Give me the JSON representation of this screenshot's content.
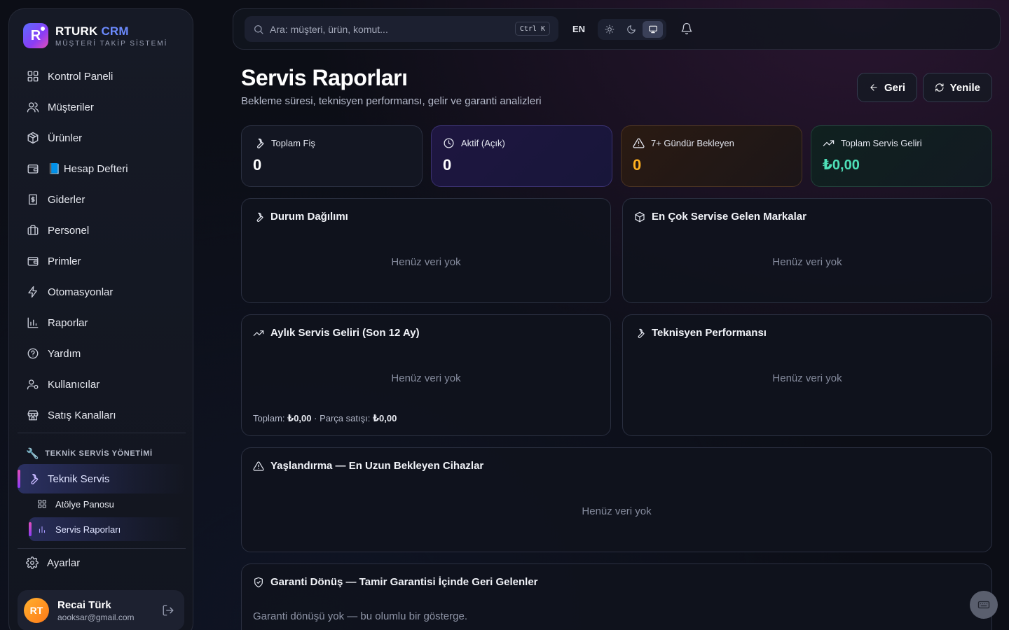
{
  "brand": {
    "name": "RTURK",
    "name_accent": "CRM",
    "subtitle": "MÜŞTERİ TAKİP SİSTEMİ",
    "logo_letter": "R"
  },
  "sidebar": {
    "items": [
      {
        "label": "Kontrol Paneli",
        "icon": "dashboard-icon"
      },
      {
        "label": "Müşteriler",
        "icon": "users-icon"
      },
      {
        "label": "Ürünler",
        "icon": "package-icon"
      },
      {
        "label": "📘 Hesap Defteri",
        "icon": "wallet-icon"
      },
      {
        "label": "Giderler",
        "icon": "receipt-icon"
      },
      {
        "label": "Personel",
        "icon": "briefcase-icon"
      },
      {
        "label": "Primler",
        "icon": "wallet-icon"
      },
      {
        "label": "Otomasyonlar",
        "icon": "zap-icon"
      },
      {
        "label": "Raporlar",
        "icon": "bar-chart-icon"
      },
      {
        "label": "Yardım",
        "icon": "help-circle-icon"
      },
      {
        "label": "Kullanıcılar",
        "icon": "user-cog-icon"
      },
      {
        "label": "Satış Kanalları",
        "icon": "store-icon"
      }
    ],
    "section_emoji": "🔧",
    "section_label": "TEKNİK SERVİS YÖNETİMİ",
    "active_item": "Teknik Servis",
    "sub_items": [
      {
        "label": "Atölye Panosu",
        "icon": "dashboard-icon"
      },
      {
        "label": "Servis Raporları",
        "icon": "bar-chart-icon"
      }
    ],
    "settings": "Ayarlar",
    "user": {
      "initials": "RT",
      "name": "Recai Türk",
      "email": "aooksar@gmail.com"
    }
  },
  "topbar": {
    "search_placeholder": "Ara: müşteri, ürün, komut...",
    "shortcut": "Ctrl K",
    "language": "EN",
    "theme_options": [
      "sun-icon",
      "moon-icon",
      "monitor-icon"
    ],
    "theme_selected": "monitor-icon"
  },
  "page": {
    "title": "Servis Raporları",
    "subtitle": "Bekleme süresi, teknisyen performansı, gelir ve garanti analizleri",
    "back_label": "Geri",
    "refresh_label": "Yenile"
  },
  "stats": [
    {
      "label": "Toplam Fiş",
      "value": "0",
      "icon": "wrench-icon"
    },
    {
      "label": "Aktif (Açık)",
      "value": "0",
      "icon": "clock-icon"
    },
    {
      "label": "7+ Gündür Bekleyen",
      "value": "0",
      "icon": "alert-triangle-icon",
      "color": "#ffb020"
    },
    {
      "label": "Toplam Servis Geliri",
      "value": "₺0,00",
      "icon": "trending-up-icon",
      "color": "#4ee0b8"
    }
  ],
  "panels": {
    "status": {
      "title": "Durum Dağılımı",
      "empty": "Henüz veri yok"
    },
    "brands": {
      "title": "En Çok Servise Gelen Markalar",
      "empty": "Henüz veri yok"
    },
    "monthly": {
      "title": "Aylık Servis Geliri (Son 12 Ay)",
      "empty": "Henüz veri yok",
      "total_label": "Toplam:",
      "total_value": "₺0,00",
      "parts_label": "· Parça satışı:",
      "parts_value": "₺0,00"
    },
    "technician": {
      "title": "Teknisyen Performansı",
      "empty": "Henüz veri yok"
    },
    "aging": {
      "title": "Yaşlandırma — En Uzun Bekleyen Cihazlar",
      "empty": "Henüz veri yok"
    },
    "warranty": {
      "title": "Garanti Dönüş — Tamir Garantisi İçinde Geri Gelenler",
      "empty": "Garanti dönüşü yok — bu olumlu bir gösterge."
    }
  }
}
